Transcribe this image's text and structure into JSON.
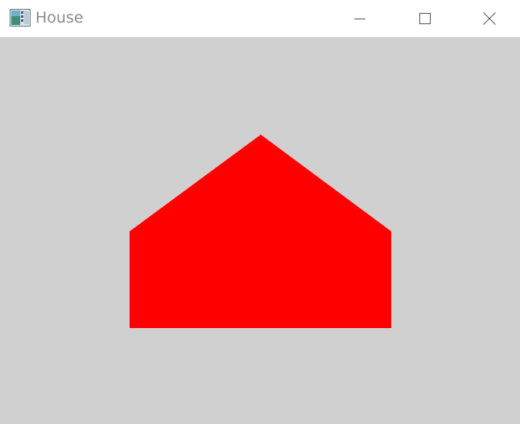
{
  "window": {
    "title": "House",
    "icons": {
      "app": "app-window-icon",
      "minimize": "minimize-icon",
      "maximize": "maximize-icon",
      "close": "close-icon"
    }
  },
  "canvas": {
    "background": "#d0d0d0",
    "shape": {
      "name": "house-shape",
      "fill": "#ff0000"
    }
  }
}
